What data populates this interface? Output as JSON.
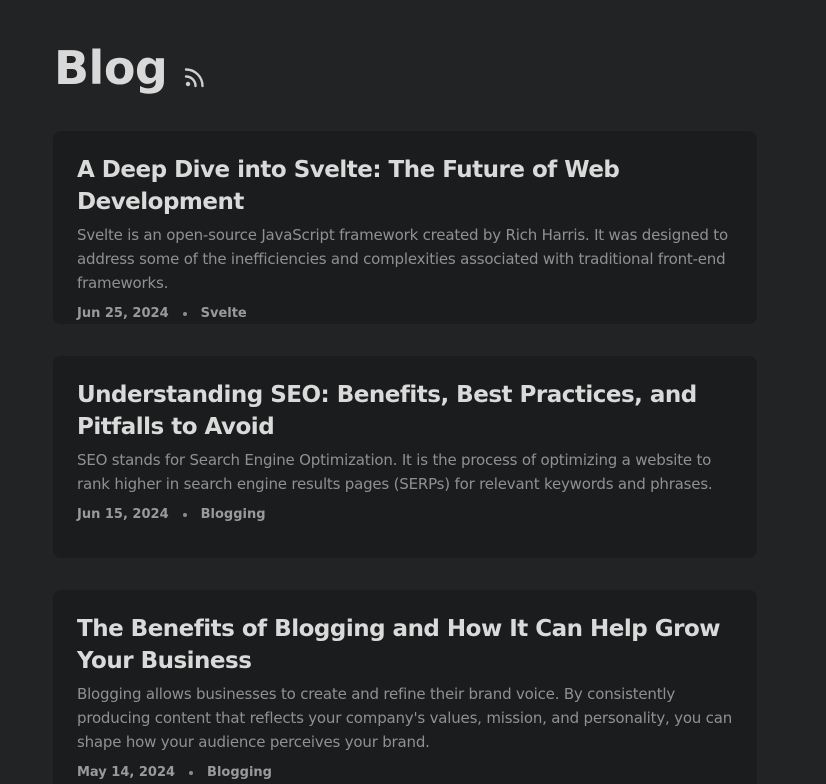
{
  "header": {
    "title": "Blog",
    "rss_icon": "rss-icon"
  },
  "posts": [
    {
      "title": "A Deep Dive into Svelte: The Future of Web Development",
      "excerpt": "Svelte is an open-source JavaScript framework created by Rich Harris. It was designed to address some of the inefficiencies and complexities associated with traditional front-end frameworks.",
      "date": "Jun 25, 2024",
      "tag": "Svelte"
    },
    {
      "title": "Understanding SEO: Benefits, Best Practices, and Pitfalls to Avoid",
      "excerpt": "SEO stands for Search Engine Optimization. It is the process of optimizing a website to rank higher in search engine results pages (SERPs) for relevant keywords and phrases.",
      "date": "Jun 15, 2024",
      "tag": "Blogging"
    },
    {
      "title": "The Benefits of Blogging and How It Can Help Grow Your Business",
      "excerpt": "Blogging allows businesses to create and refine their brand voice. By consistently producing content that reflects your company's values, mission, and personality, you can shape how your audience perceives your brand.",
      "date": "May 14, 2024",
      "tag": "Blogging"
    }
  ]
}
